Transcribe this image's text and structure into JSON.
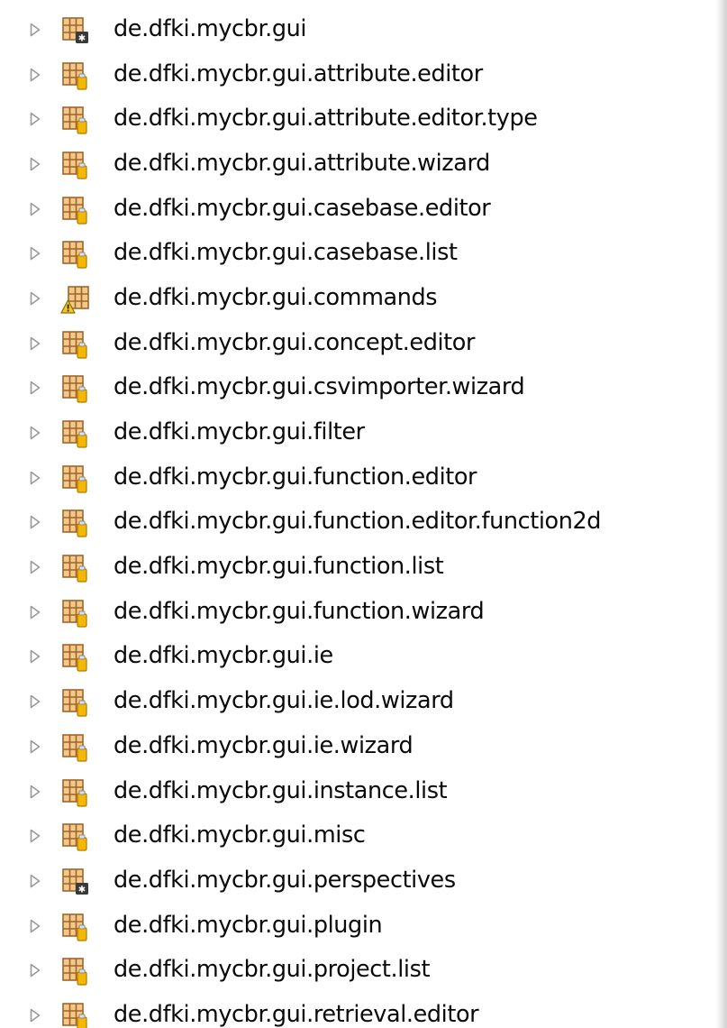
{
  "tree": {
    "items": [
      {
        "label": "de.dfki.mycbr.gui",
        "icon": "package-binary-icon",
        "overlay": "binary"
      },
      {
        "label": "de.dfki.mycbr.gui.attribute.editor",
        "icon": "package-jar-icon",
        "overlay": "jar"
      },
      {
        "label": "de.dfki.mycbr.gui.attribute.editor.type",
        "icon": "package-jar-icon",
        "overlay": "jar"
      },
      {
        "label": "de.dfki.mycbr.gui.attribute.wizard",
        "icon": "package-jar-icon",
        "overlay": "jar"
      },
      {
        "label": "de.dfki.mycbr.gui.casebase.editor",
        "icon": "package-jar-icon",
        "overlay": "jar"
      },
      {
        "label": "de.dfki.mycbr.gui.casebase.list",
        "icon": "package-jar-icon",
        "overlay": "jar"
      },
      {
        "label": "de.dfki.mycbr.gui.commands",
        "icon": "package-warning-icon",
        "overlay": "warning"
      },
      {
        "label": "de.dfki.mycbr.gui.concept.editor",
        "icon": "package-jar-icon",
        "overlay": "jar"
      },
      {
        "label": "de.dfki.mycbr.gui.csvimporter.wizard",
        "icon": "package-jar-icon",
        "overlay": "jar"
      },
      {
        "label": "de.dfki.mycbr.gui.filter",
        "icon": "package-jar-icon",
        "overlay": "jar"
      },
      {
        "label": "de.dfki.mycbr.gui.function.editor",
        "icon": "package-jar-icon",
        "overlay": "jar"
      },
      {
        "label": "de.dfki.mycbr.gui.function.editor.function2d",
        "icon": "package-jar-icon",
        "overlay": "jar"
      },
      {
        "label": "de.dfki.mycbr.gui.function.list",
        "icon": "package-jar-icon",
        "overlay": "jar"
      },
      {
        "label": "de.dfki.mycbr.gui.function.wizard",
        "icon": "package-jar-icon",
        "overlay": "jar"
      },
      {
        "label": "de.dfki.mycbr.gui.ie",
        "icon": "package-jar-icon",
        "overlay": "jar"
      },
      {
        "label": "de.dfki.mycbr.gui.ie.lod.wizard",
        "icon": "package-jar-icon",
        "overlay": "jar"
      },
      {
        "label": "de.dfki.mycbr.gui.ie.wizard",
        "icon": "package-jar-icon",
        "overlay": "jar"
      },
      {
        "label": "de.dfki.mycbr.gui.instance.list",
        "icon": "package-jar-icon",
        "overlay": "jar"
      },
      {
        "label": "de.dfki.mycbr.gui.misc",
        "icon": "package-jar-icon",
        "overlay": "jar"
      },
      {
        "label": "de.dfki.mycbr.gui.perspectives",
        "icon": "package-binary-icon",
        "overlay": "binary"
      },
      {
        "label": "de.dfki.mycbr.gui.plugin",
        "icon": "package-jar-icon",
        "overlay": "jar"
      },
      {
        "label": "de.dfki.mycbr.gui.project.list",
        "icon": "package-jar-icon",
        "overlay": "jar"
      },
      {
        "label": "de.dfki.mycbr.gui.retrieval.editor",
        "icon": "package-jar-icon",
        "overlay": "jar"
      }
    ]
  },
  "colors": {
    "package_fill": "#f2c98a",
    "package_stroke": "#a0652a",
    "jar_overlay": "#f5b800",
    "binary_overlay": "#3a3a3a",
    "warning_overlay": "#f3c623",
    "text": "#0a0a0a",
    "twisty": "#9a9a9a"
  }
}
